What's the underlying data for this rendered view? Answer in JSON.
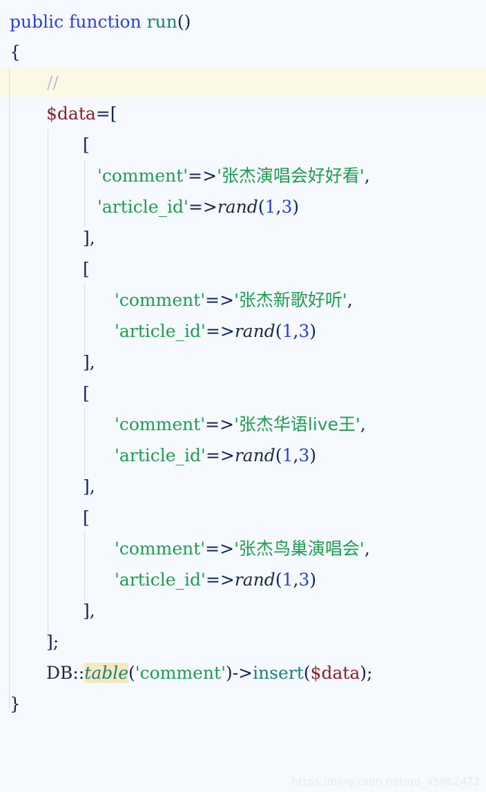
{
  "editor": {
    "language": "PHP",
    "background_color": "#f6f9fd",
    "highlight_line_color": "#fbf8e6",
    "indent_guide_color": "#d9dde4",
    "token_colors": {
      "keyword": "#2b41d8",
      "function": "#1a7f7f",
      "string": "#1e9c52",
      "number": "#2b41d8",
      "variable": "#8a1f29",
      "punctuation": "#12215c",
      "comment": "#b9bfc9",
      "search_highlight": "#f7e8bd"
    }
  },
  "code": {
    "line01": {
      "kw_public": "public",
      "sp1": " ",
      "kw_function": "function",
      "sp2": " ",
      "fn_name": "run",
      "parens": "()"
    },
    "line02": {
      "brace_open": "{"
    },
    "line03": {
      "comment": "//"
    },
    "line04": {
      "var": "$data",
      "eq": "=",
      "bracket": "["
    },
    "line05": {
      "bracket": "["
    },
    "line06": {
      "key": "'comment'",
      "arrow": "=>",
      "value": "'张杰演唱会好好看'",
      "comma": ","
    },
    "line07": {
      "key": "'article_id'",
      "arrow": "=>",
      "fn": "rand",
      "lp": "(",
      "n1": "1",
      "sep": ",",
      "n2": "3",
      "rp": ")"
    },
    "line08": {
      "close": "]",
      "comma": ","
    },
    "line09": {
      "bracket": "["
    },
    "line10": {
      "key": "'comment'",
      "arrow": "=>",
      "value": "'张杰新歌好听'",
      "comma": ","
    },
    "line11": {
      "key": "'article_id'",
      "arrow": "=>",
      "fn": "rand",
      "lp": "(",
      "n1": "1",
      "sep": ",",
      "n2": "3",
      "rp": ")"
    },
    "line12": {
      "close": "]",
      "comma": ","
    },
    "line13": {
      "bracket": "["
    },
    "line14": {
      "key": "'comment'",
      "arrow": "=>",
      "value": "'张杰华语live王'",
      "comma": ","
    },
    "line15": {
      "key": "'article_id'",
      "arrow": "=>",
      "fn": "rand",
      "lp": "(",
      "n1": "1",
      "sep": ",",
      "n2": "3",
      "rp": ")"
    },
    "line16": {
      "close": "]",
      "comma": ","
    },
    "line17": {
      "bracket": "["
    },
    "line18": {
      "key": "'comment'",
      "arrow": "=>",
      "value": "'张杰鸟巢演唱会'",
      "comma": ","
    },
    "line19": {
      "key": "'article_id'",
      "arrow": "=>",
      "fn": "rand",
      "lp": "(",
      "n1": "1",
      "sep": ",",
      "n2": "3",
      "rp": ")"
    },
    "line20": {
      "close": "]",
      "comma": ","
    },
    "line21": {
      "close": "]",
      "semi": ";"
    },
    "line22": {
      "class": "DB",
      "scope": "::",
      "method": "table",
      "lp": "(",
      "arg": "'comment'",
      "rp": ")",
      "objop": "->",
      "method2": "insert",
      "lp2": "(",
      "arg2": "$data",
      "rp2": ")",
      "semi": ";"
    },
    "line23": {
      "brace_close": "}"
    }
  },
  "watermark": {
    "text": "https://blog.csdn.net/qq_45062472"
  }
}
